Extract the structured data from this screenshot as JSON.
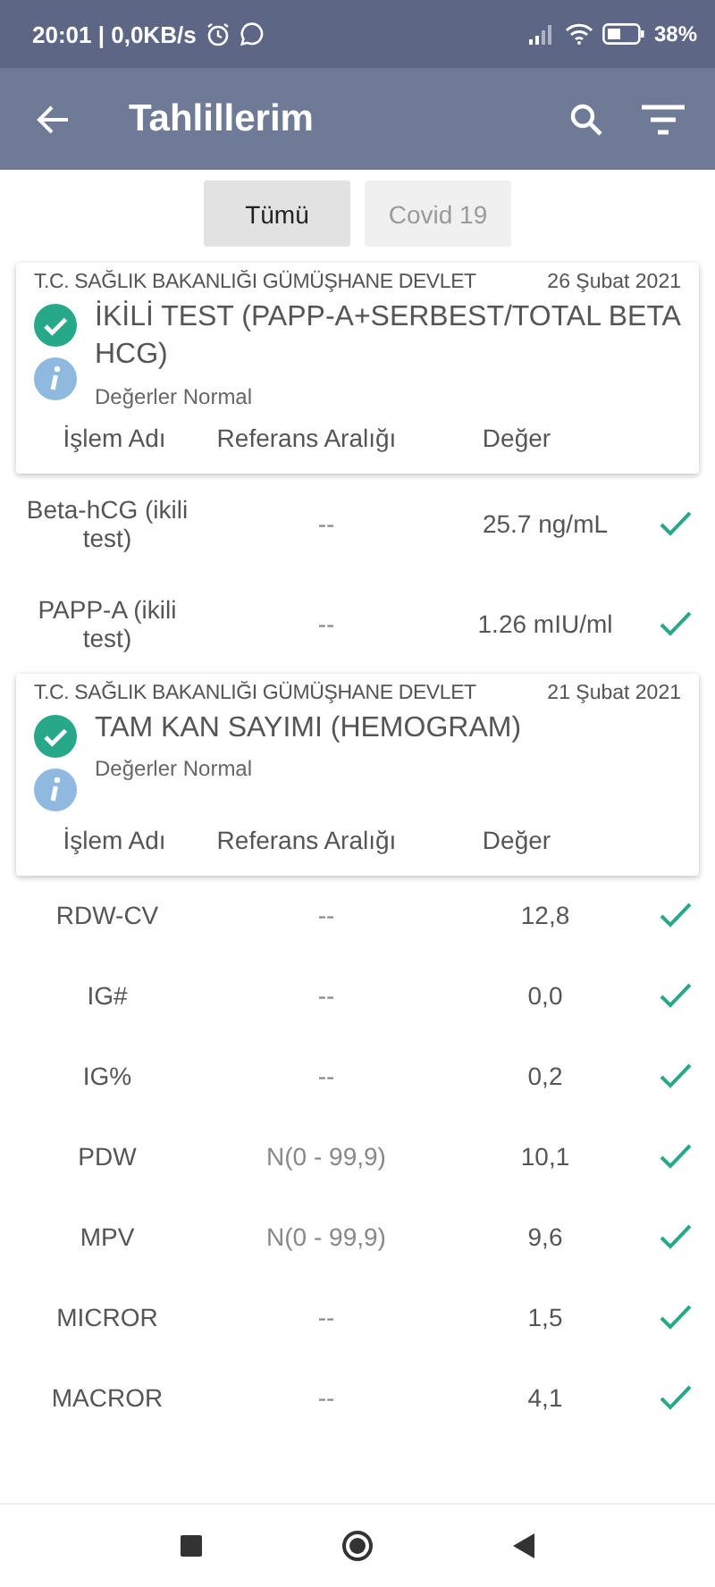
{
  "status_bar": {
    "time": "20:01 | 0,0KB/s",
    "battery": "38%"
  },
  "app_bar": {
    "title": "Tahlillerim"
  },
  "filters": [
    {
      "label": "Tümü",
      "selected": true
    },
    {
      "label": "Covid 19",
      "selected": false
    }
  ],
  "results": [
    {
      "institution": "T.C. SAĞLIK BAKANLIĞI GÜMÜŞHANE DEVLET",
      "date": "26 Şubat 2021",
      "title": "İKİLİ TEST (PAPP-A+SERBEST/TOTAL BETA HCG)",
      "normal": true,
      "summary": "Değerler Normal",
      "columns": [
        "İşlem Adı",
        "Referans Aralığı",
        "Değer"
      ],
      "rows": [
        {
          "name": "Beta-hCG (ikili test)",
          "reference": "--",
          "value": "25.7 ng/mL",
          "normal": true
        },
        {
          "name": "PAPP-A (ikili test)",
          "reference": "--",
          "value": "1.26 mIU/ml",
          "normal": true
        }
      ]
    },
    {
      "institution": "T.C. SAĞLIK BAKANLIĞI GÜMÜŞHANE DEVLET",
      "date": "21 Şubat 2021",
      "title": "TAM KAN SAYIMI (HEMOGRAM)",
      "normal": true,
      "summary": "Değerler Normal",
      "columns": [
        "İşlem Adı",
        "Referans Aralığı",
        "Değer"
      ],
      "rows": [
        {
          "name": "RDW-CV",
          "reference": "--",
          "value": "12,8",
          "normal": true
        },
        {
          "name": "IG#",
          "reference": "--",
          "value": "0,0",
          "normal": true
        },
        {
          "name": "IG%",
          "reference": "--",
          "value": "0,2",
          "normal": true
        },
        {
          "name": "PDW",
          "reference": "N(0 - 99,9)",
          "value": "10,1",
          "normal": true
        },
        {
          "name": "MPV",
          "reference": "N(0 - 99,9)",
          "value": "9,6",
          "normal": true
        },
        {
          "name": "MICROR",
          "reference": "--",
          "value": "1,5",
          "normal": true
        },
        {
          "name": "MACROR",
          "reference": "--",
          "value": "4,1",
          "normal": true
        }
      ]
    }
  ]
}
